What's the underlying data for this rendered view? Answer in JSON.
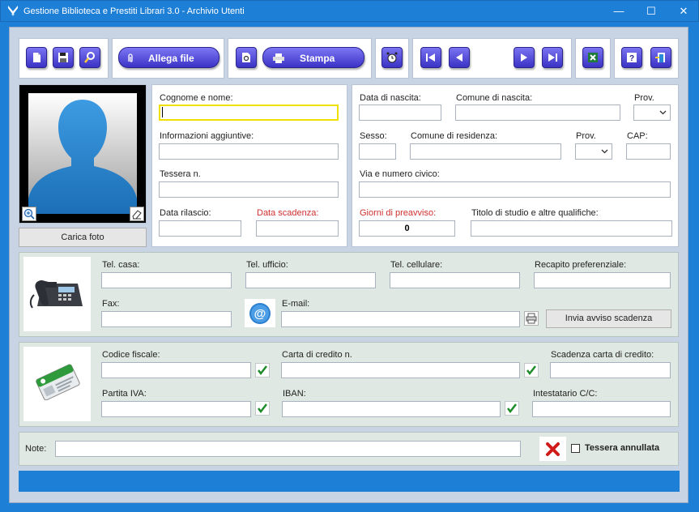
{
  "window": {
    "title": "Gestione Biblioteca e Prestiti Librari 3.0 - Archivio Utenti",
    "minimize": "—",
    "maximize": "☐",
    "close": "✕"
  },
  "toolbar": {
    "attach_label": "Allega file",
    "print_label": "Stampa"
  },
  "photo": {
    "load_label": "Carica foto"
  },
  "personal": {
    "name_label": "Cognome e nome:",
    "name_value": "",
    "extra_label": "Informazioni aggiuntive:",
    "card_label": "Tessera n.",
    "issue_label": "Data rilascio:",
    "expiry_label": "Data scadenza:",
    "birth_label": "Data di nascita:",
    "birthplace_label": "Comune di nascita:",
    "prov_label": "Prov.",
    "sex_label": "Sesso:",
    "residence_label": "Comune di residenza:",
    "prov2_label": "Prov.",
    "cap_label": "CAP:",
    "street_label": "Via e numero civico:",
    "notice_label": "Giorni di preavviso:",
    "notice_value": "0",
    "degree_label": "Titolo di studio e altre qualifiche:"
  },
  "contacts": {
    "home_label": "Tel. casa:",
    "office_label": "Tel. ufficio:",
    "mobile_label": "Tel. cellulare:",
    "preferred_label": "Recapito preferenziale:",
    "fax_label": "Fax:",
    "email_label": "E-mail:",
    "send_notice_label": "Invia avviso scadenza"
  },
  "billing": {
    "tax_code_label": "Codice fiscale:",
    "card_number_label": "Carta di credito n.",
    "card_expiry_label": "Scadenza carta di credito:",
    "vat_label": "Partita IVA:",
    "iban_label": "IBAN:",
    "holder_label": "Intestatario C/C:"
  },
  "notes": {
    "label": "Note:",
    "cancelled_label": "Tessera annullata"
  },
  "colors": {
    "accent": "#1e7fd6",
    "button": "#3b33c6",
    "focus": "#f0e000"
  }
}
